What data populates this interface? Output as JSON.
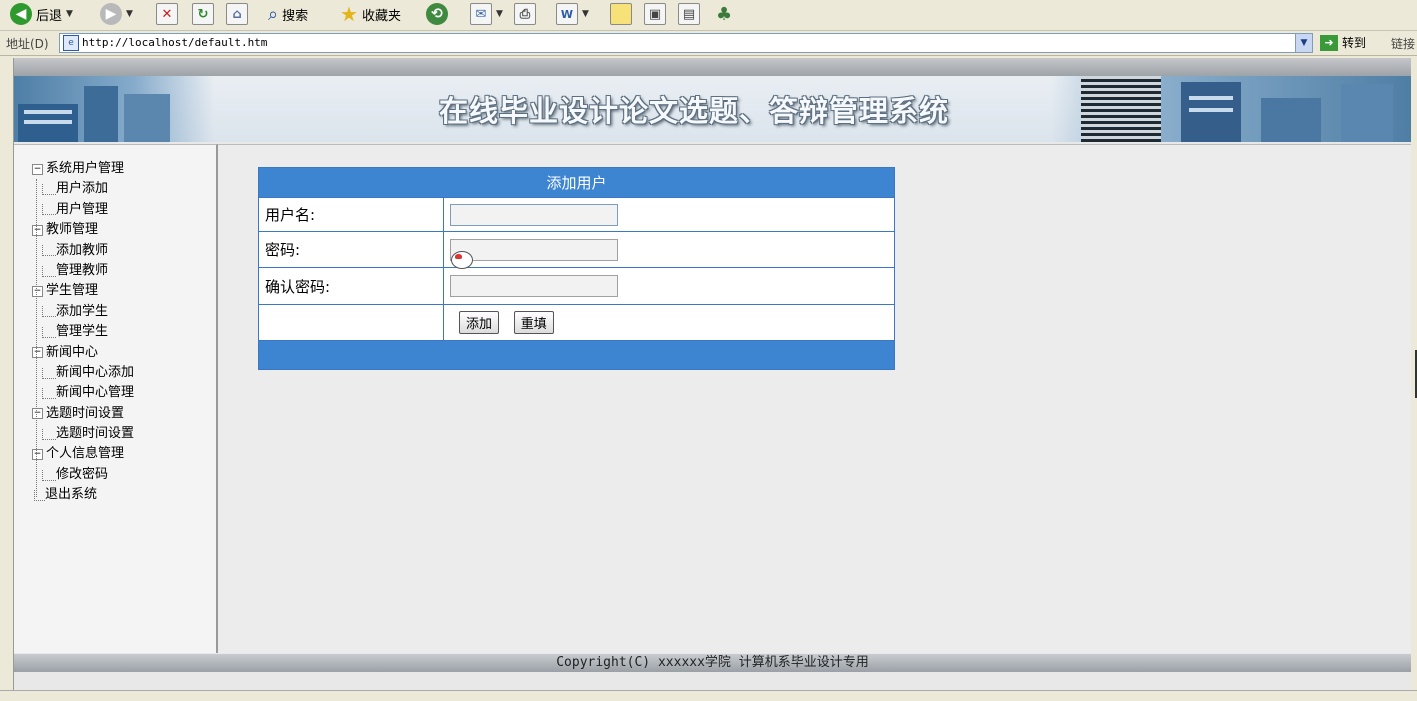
{
  "toolbar": {
    "back_label": "后退",
    "search_label": "搜索",
    "favorites_label": "收藏夹"
  },
  "address_bar": {
    "label": "地址(D)",
    "url": "http://localhost/default.htm",
    "go_label": "转到",
    "links_label": "链接"
  },
  "banner": {
    "title": "在线毕业设计论文选题、答辩管理系统"
  },
  "sidebar": {
    "groups": [
      {
        "label": "系统用户管理",
        "items": [
          "用户添加",
          "用户管理"
        ]
      },
      {
        "label": "教师管理",
        "items": [
          "添加教师",
          "管理教师"
        ]
      },
      {
        "label": "学生管理",
        "items": [
          "添加学生",
          "管理学生"
        ]
      },
      {
        "label": "新闻中心",
        "items": [
          "新闻中心添加",
          "新闻中心管理"
        ]
      },
      {
        "label": "选题时间设置",
        "items": [
          "选题时间设置"
        ]
      },
      {
        "label": "个人信息管理",
        "items": [
          "修改密码"
        ]
      }
    ],
    "exit_label": "退出系统",
    "toggle_symbol": "−"
  },
  "form": {
    "title": "添加用户",
    "username_label": "用户名:",
    "username_value": "",
    "password_label": "密码:",
    "password_value": "",
    "confirm_label": "确认密码:",
    "confirm_value": "",
    "add_button": "添加",
    "reset_button": "重填"
  },
  "footer": {
    "copyright": "Copyright(C) xxxxxx学院 计算机系毕业设计专用"
  },
  "colors": {
    "accent": "#3d85d1",
    "border": "#3a78c7"
  }
}
